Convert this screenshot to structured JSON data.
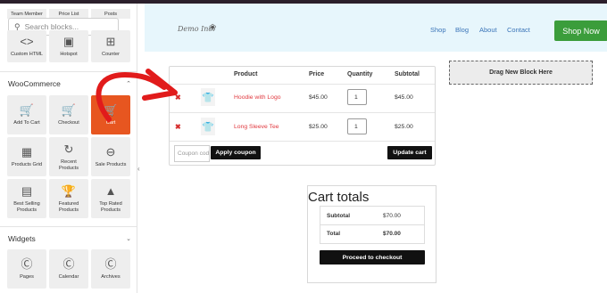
{
  "sidebar": {
    "partial_top": [
      "Team Member",
      "Price List",
      "Posts"
    ],
    "search_placeholder": "Search blocks...",
    "top_tiles": [
      {
        "label": "Custom HTML",
        "icon": "code-icon"
      },
      {
        "label": "Hotspot",
        "icon": "image-icon"
      },
      {
        "label": "Counter",
        "icon": "counter-icon"
      }
    ],
    "woocommerce": {
      "heading": "WooCommerce",
      "tiles": [
        {
          "label": "Add To Cart",
          "icon": "add-to-cart-icon",
          "active": false
        },
        {
          "label": "Checkout",
          "icon": "checkout-cart-icon",
          "active": false
        },
        {
          "label": "Cart",
          "icon": "cart-icon",
          "active": true
        },
        {
          "label": "Products Grid",
          "icon": "grid-list-icon",
          "active": false
        },
        {
          "label": "Recent Products",
          "icon": "clock-icon",
          "active": false
        },
        {
          "label": "Sale Products",
          "icon": "sale-icon",
          "active": false
        },
        {
          "label": "Best Selling Products",
          "icon": "best-selling-icon",
          "active": false
        },
        {
          "label": "Featured Products",
          "icon": "trophy-icon",
          "active": false
        },
        {
          "label": "Top Rated Products",
          "icon": "top-rated-icon",
          "active": false
        }
      ]
    },
    "widgets": {
      "heading": "Widgets",
      "tiles": [
        {
          "label": "Pages",
          "icon": "wordpress-icon"
        },
        {
          "label": "Calendar",
          "icon": "wordpress-icon"
        },
        {
          "label": "Archives",
          "icon": "wordpress-icon"
        }
      ]
    },
    "active_color": "#e75620"
  },
  "header": {
    "logo_text": "Demo Inc.",
    "nav": [
      "Shop",
      "Blog",
      "About",
      "Contact"
    ],
    "cta": "Shop Now",
    "cta_color": "#3b9d3b"
  },
  "cart": {
    "columns": [
      "Product",
      "Price",
      "Quantity",
      "Subtotal"
    ],
    "rows": [
      {
        "name": "Hoodie with Logo",
        "price": "$45.00",
        "qty": "1",
        "subtotal": "$45.00"
      },
      {
        "name": "Long Sleeve Tee",
        "price": "$25.00",
        "qty": "1",
        "subtotal": "$25.00"
      }
    ],
    "coupon_placeholder": "Coupon code",
    "apply_coupon": "Apply coupon",
    "update_cart": "Update cart"
  },
  "dropzone": "Drag New Block Here",
  "totals": {
    "title": "Cart totals",
    "subtotal_label": "Subtotal",
    "subtotal_value": "$70.00",
    "total_label": "Total",
    "total_value": "$70.00",
    "checkout": "Proceed to checkout"
  }
}
